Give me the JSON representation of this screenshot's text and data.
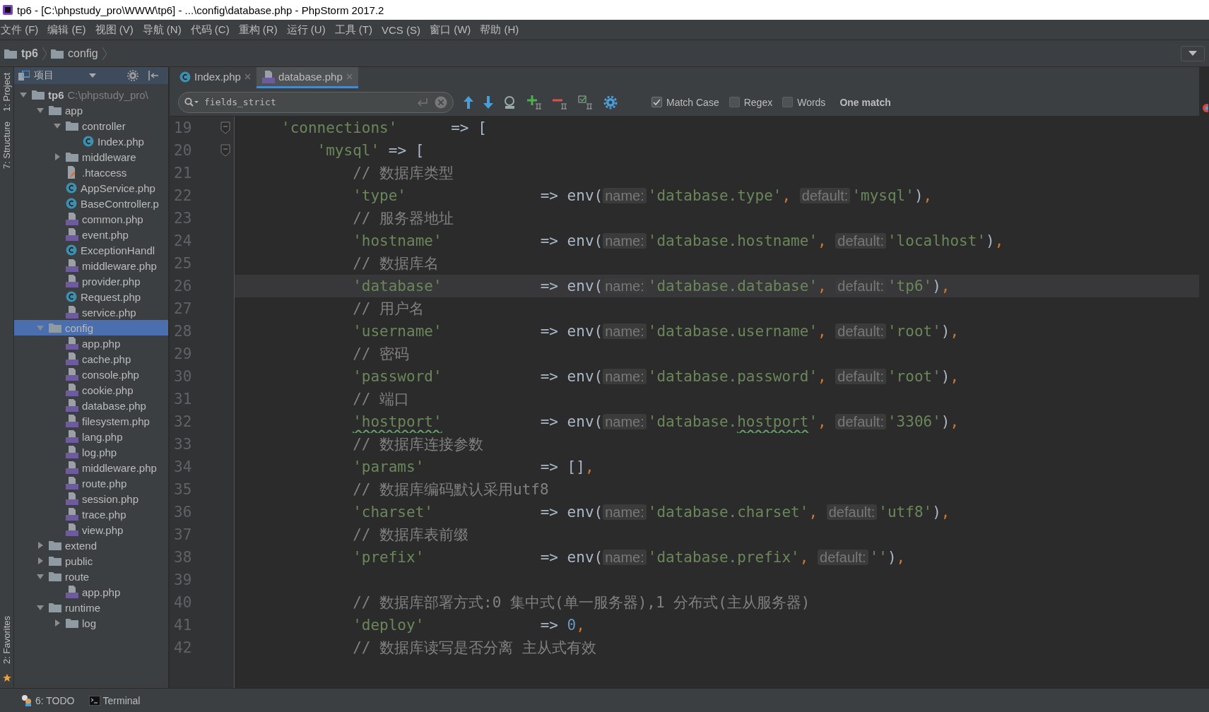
{
  "window": {
    "title": "tp6 - [C:\\phpstudy_pro\\WWW\\tp6] - ...\\config\\database.php - PhpStorm 2017.2"
  },
  "menu": [
    "文件 (F)",
    "编辑 (E)",
    "视图 (V)",
    "导航 (N)",
    "代码 (C)",
    "重构 (R)",
    "运行 (U)",
    "工具 (T)",
    "VCS (S)",
    "窗口 (W)",
    "帮助 (H)"
  ],
  "breadcrumb": [
    "tp6",
    "config"
  ],
  "tool_strip": {
    "top": [
      "1: Project",
      "7: Structure"
    ],
    "bottom": [
      "2: Favorites"
    ]
  },
  "project": {
    "title": "项目",
    "tree": [
      {
        "label": "tp6",
        "path": "C:\\phpstudy_pro\\",
        "kind": "folder",
        "expanded": true,
        "selected": false,
        "children": [
          {
            "label": "app",
            "kind": "folder",
            "expanded": true,
            "selected": false,
            "children": [
              {
                "label": "controller",
                "kind": "folder",
                "expanded": true,
                "selected": false,
                "children": [
                  {
                    "label": "Index.php",
                    "kind": "class",
                    "selected": false
                  }
                ]
              },
              {
                "label": "middleware",
                "kind": "folder",
                "expanded": false,
                "selected": false
              },
              {
                "label": ".htaccess",
                "kind": "htaccess",
                "selected": false
              },
              {
                "label": "AppService.php",
                "kind": "class",
                "selected": false
              },
              {
                "label": "BaseController.p",
                "kind": "class",
                "selected": false
              },
              {
                "label": "common.php",
                "kind": "php",
                "selected": false
              },
              {
                "label": "event.php",
                "kind": "php",
                "selected": false
              },
              {
                "label": "ExceptionHandl",
                "kind": "class",
                "selected": false
              },
              {
                "label": "middleware.php",
                "kind": "php",
                "selected": false
              },
              {
                "label": "provider.php",
                "kind": "php",
                "selected": false
              },
              {
                "label": "Request.php",
                "kind": "class",
                "selected": false
              },
              {
                "label": "service.php",
                "kind": "php",
                "selected": false
              }
            ]
          },
          {
            "label": "config",
            "kind": "folder",
            "expanded": true,
            "selected": true,
            "children": [
              {
                "label": "app.php",
                "kind": "php",
                "selected": false
              },
              {
                "label": "cache.php",
                "kind": "php",
                "selected": false
              },
              {
                "label": "console.php",
                "kind": "php",
                "selected": false
              },
              {
                "label": "cookie.php",
                "kind": "php",
                "selected": false
              },
              {
                "label": "database.php",
                "kind": "php",
                "selected": false
              },
              {
                "label": "filesystem.php",
                "kind": "php",
                "selected": false
              },
              {
                "label": "lang.php",
                "kind": "php",
                "selected": false
              },
              {
                "label": "log.php",
                "kind": "php",
                "selected": false
              },
              {
                "label": "middleware.php",
                "kind": "php",
                "selected": false
              },
              {
                "label": "route.php",
                "kind": "php",
                "selected": false
              },
              {
                "label": "session.php",
                "kind": "php",
                "selected": false
              },
              {
                "label": "trace.php",
                "kind": "php",
                "selected": false
              },
              {
                "label": "view.php",
                "kind": "php",
                "selected": false
              }
            ]
          },
          {
            "label": "extend",
            "kind": "folder",
            "expanded": false,
            "selected": false
          },
          {
            "label": "public",
            "kind": "folder",
            "expanded": false,
            "selected": false
          },
          {
            "label": "route",
            "kind": "folder",
            "expanded": true,
            "selected": false,
            "children": [
              {
                "label": "app.php",
                "kind": "php",
                "selected": false
              }
            ]
          },
          {
            "label": "runtime",
            "kind": "folder",
            "expanded": true,
            "selected": false,
            "children": [
              {
                "label": "log",
                "kind": "folder",
                "expanded": false,
                "selected": false
              }
            ]
          }
        ]
      }
    ]
  },
  "tabs": [
    {
      "label": "Index.php",
      "kind": "class",
      "selected": false
    },
    {
      "label": "database.php",
      "kind": "php",
      "selected": true
    }
  ],
  "find": {
    "value": "fields_strict",
    "options": [
      {
        "label": "Match Case",
        "checked": true
      },
      {
        "label": "Regex",
        "checked": false
      },
      {
        "label": "Words",
        "checked": false
      }
    ],
    "result": "One match"
  },
  "gutter": [
    {
      "n": "19",
      "current": false
    },
    {
      "n": "20",
      "current": false
    },
    {
      "n": "21",
      "current": false
    },
    {
      "n": "22",
      "current": false
    },
    {
      "n": "23",
      "current": false
    },
    {
      "n": "24",
      "current": false
    },
    {
      "n": "25",
      "current": false
    },
    {
      "n": "26",
      "current": true
    },
    {
      "n": "27",
      "current": false
    },
    {
      "n": "28",
      "current": false
    },
    {
      "n": "29",
      "current": false
    },
    {
      "n": "30",
      "current": false
    },
    {
      "n": "31",
      "current": false
    },
    {
      "n": "32",
      "current": false
    },
    {
      "n": "33",
      "current": false
    },
    {
      "n": "34",
      "current": false
    },
    {
      "n": "35",
      "current": false
    },
    {
      "n": "36",
      "current": false
    },
    {
      "n": "37",
      "current": false
    },
    {
      "n": "38",
      "current": false
    },
    {
      "n": "39",
      "current": false
    },
    {
      "n": "40",
      "current": false
    },
    {
      "n": "41",
      "current": false
    },
    {
      "n": "42",
      "current": false
    }
  ],
  "code": [
    {
      "kind": "open",
      "key": "'connections'",
      "op": "=> [",
      "children": [
        {
          "kind": "open",
          "key": "'mysql'",
          "op": "=> [",
          "children": [
            {
              "kind": "comment",
              "text": "// 数据库类型"
            },
            {
              "kind": "env",
              "key": "'type'",
              "arrow": "=>",
              "call": "env(",
              "name_hint": "name:",
              "name": "'database.type'",
              "sep": ",",
              "default_hint": "default:",
              "default": "'mysql'",
              "close": ")",
              "tail": ","
            },
            {
              "kind": "comment",
              "text": "// 服务器地址"
            },
            {
              "kind": "env",
              "key": "'hostname'",
              "arrow": "=>",
              "call": "env(",
              "name_hint": "name:",
              "name": "'database.hostname'",
              "sep": ",",
              "default_hint": "default:",
              "default": "'localhost'",
              "close": ")",
              "tail": ","
            },
            {
              "kind": "comment",
              "text": "// 数据库名"
            },
            {
              "kind": "env",
              "key": "'database'",
              "arrow": "=>",
              "call": "env(",
              "name_hint": "name:",
              "name": "'database.database'",
              "sep": ",",
              "default_hint": "default:",
              "default": "'tp6'",
              "close": ")",
              "tail": ","
            },
            {
              "kind": "comment",
              "text": "// 用户名"
            },
            {
              "kind": "env",
              "key": "'username'",
              "arrow": "=>",
              "call": "env(",
              "name_hint": "name:",
              "name": "'database.username'",
              "sep": ",",
              "default_hint": "default:",
              "default": "'root'",
              "close": ")",
              "tail": ","
            },
            {
              "kind": "comment",
              "text": "// 密码"
            },
            {
              "kind": "env",
              "key": "'password'",
              "arrow": "=>",
              "call": "env(",
              "name_hint": "name:",
              "name": "'database.password'",
              "sep": ",",
              "default_hint": "default:",
              "default": "'root'",
              "close": ")",
              "tail": ","
            },
            {
              "kind": "comment",
              "text": "// 端口"
            },
            {
              "kind": "env",
              "key": "'hostport'",
              "typo": true,
              "arrow": "=>",
              "call": "env(",
              "name_hint": "name:",
              "name": "'database.hostport'",
              "sep": ",",
              "default_hint": "default:",
              "default": "'3306'",
              "close": ")",
              "tail": ","
            },
            {
              "kind": "comment",
              "text": "// 数据库连接参数"
            },
            {
              "kind": "value",
              "key": "'params'",
              "arrow": "=>",
              "value": "[]",
              "tail": ","
            },
            {
              "kind": "comment",
              "text": "// 数据库编码默认采用utf8"
            },
            {
              "kind": "env",
              "key": "'charset'",
              "arrow": "=>",
              "call": "env(",
              "name_hint": "name:",
              "name": "'database.charset'",
              "sep": ",",
              "default_hint": "default:",
              "default": "'utf8'",
              "close": ")",
              "tail": ","
            },
            {
              "kind": "comment",
              "text": "// 数据库表前缀"
            },
            {
              "kind": "env",
              "key": "'prefix'",
              "arrow": "=>",
              "call": "env(",
              "name_hint": "name:",
              "name": "'database.prefix'",
              "sep": ",",
              "default_hint": "default:",
              "default": "''",
              "close": ")",
              "tail": ","
            },
            {
              "kind": "blank"
            },
            {
              "kind": "comment",
              "text": "// 数据库部署方式:0 集中式(单一服务器),1 分布式(主从服务器)"
            },
            {
              "kind": "number",
              "key": "'deploy'",
              "arrow": "=>",
              "value": "0",
              "tail": ","
            },
            {
              "kind": "comment",
              "text": "// 数据库读写是否分离 主从式有效"
            }
          ]
        }
      ]
    }
  ],
  "bottom_bar": [
    {
      "label": "6: TODO",
      "kind": "todo"
    },
    {
      "label": "Terminal",
      "kind": "terminal"
    }
  ]
}
